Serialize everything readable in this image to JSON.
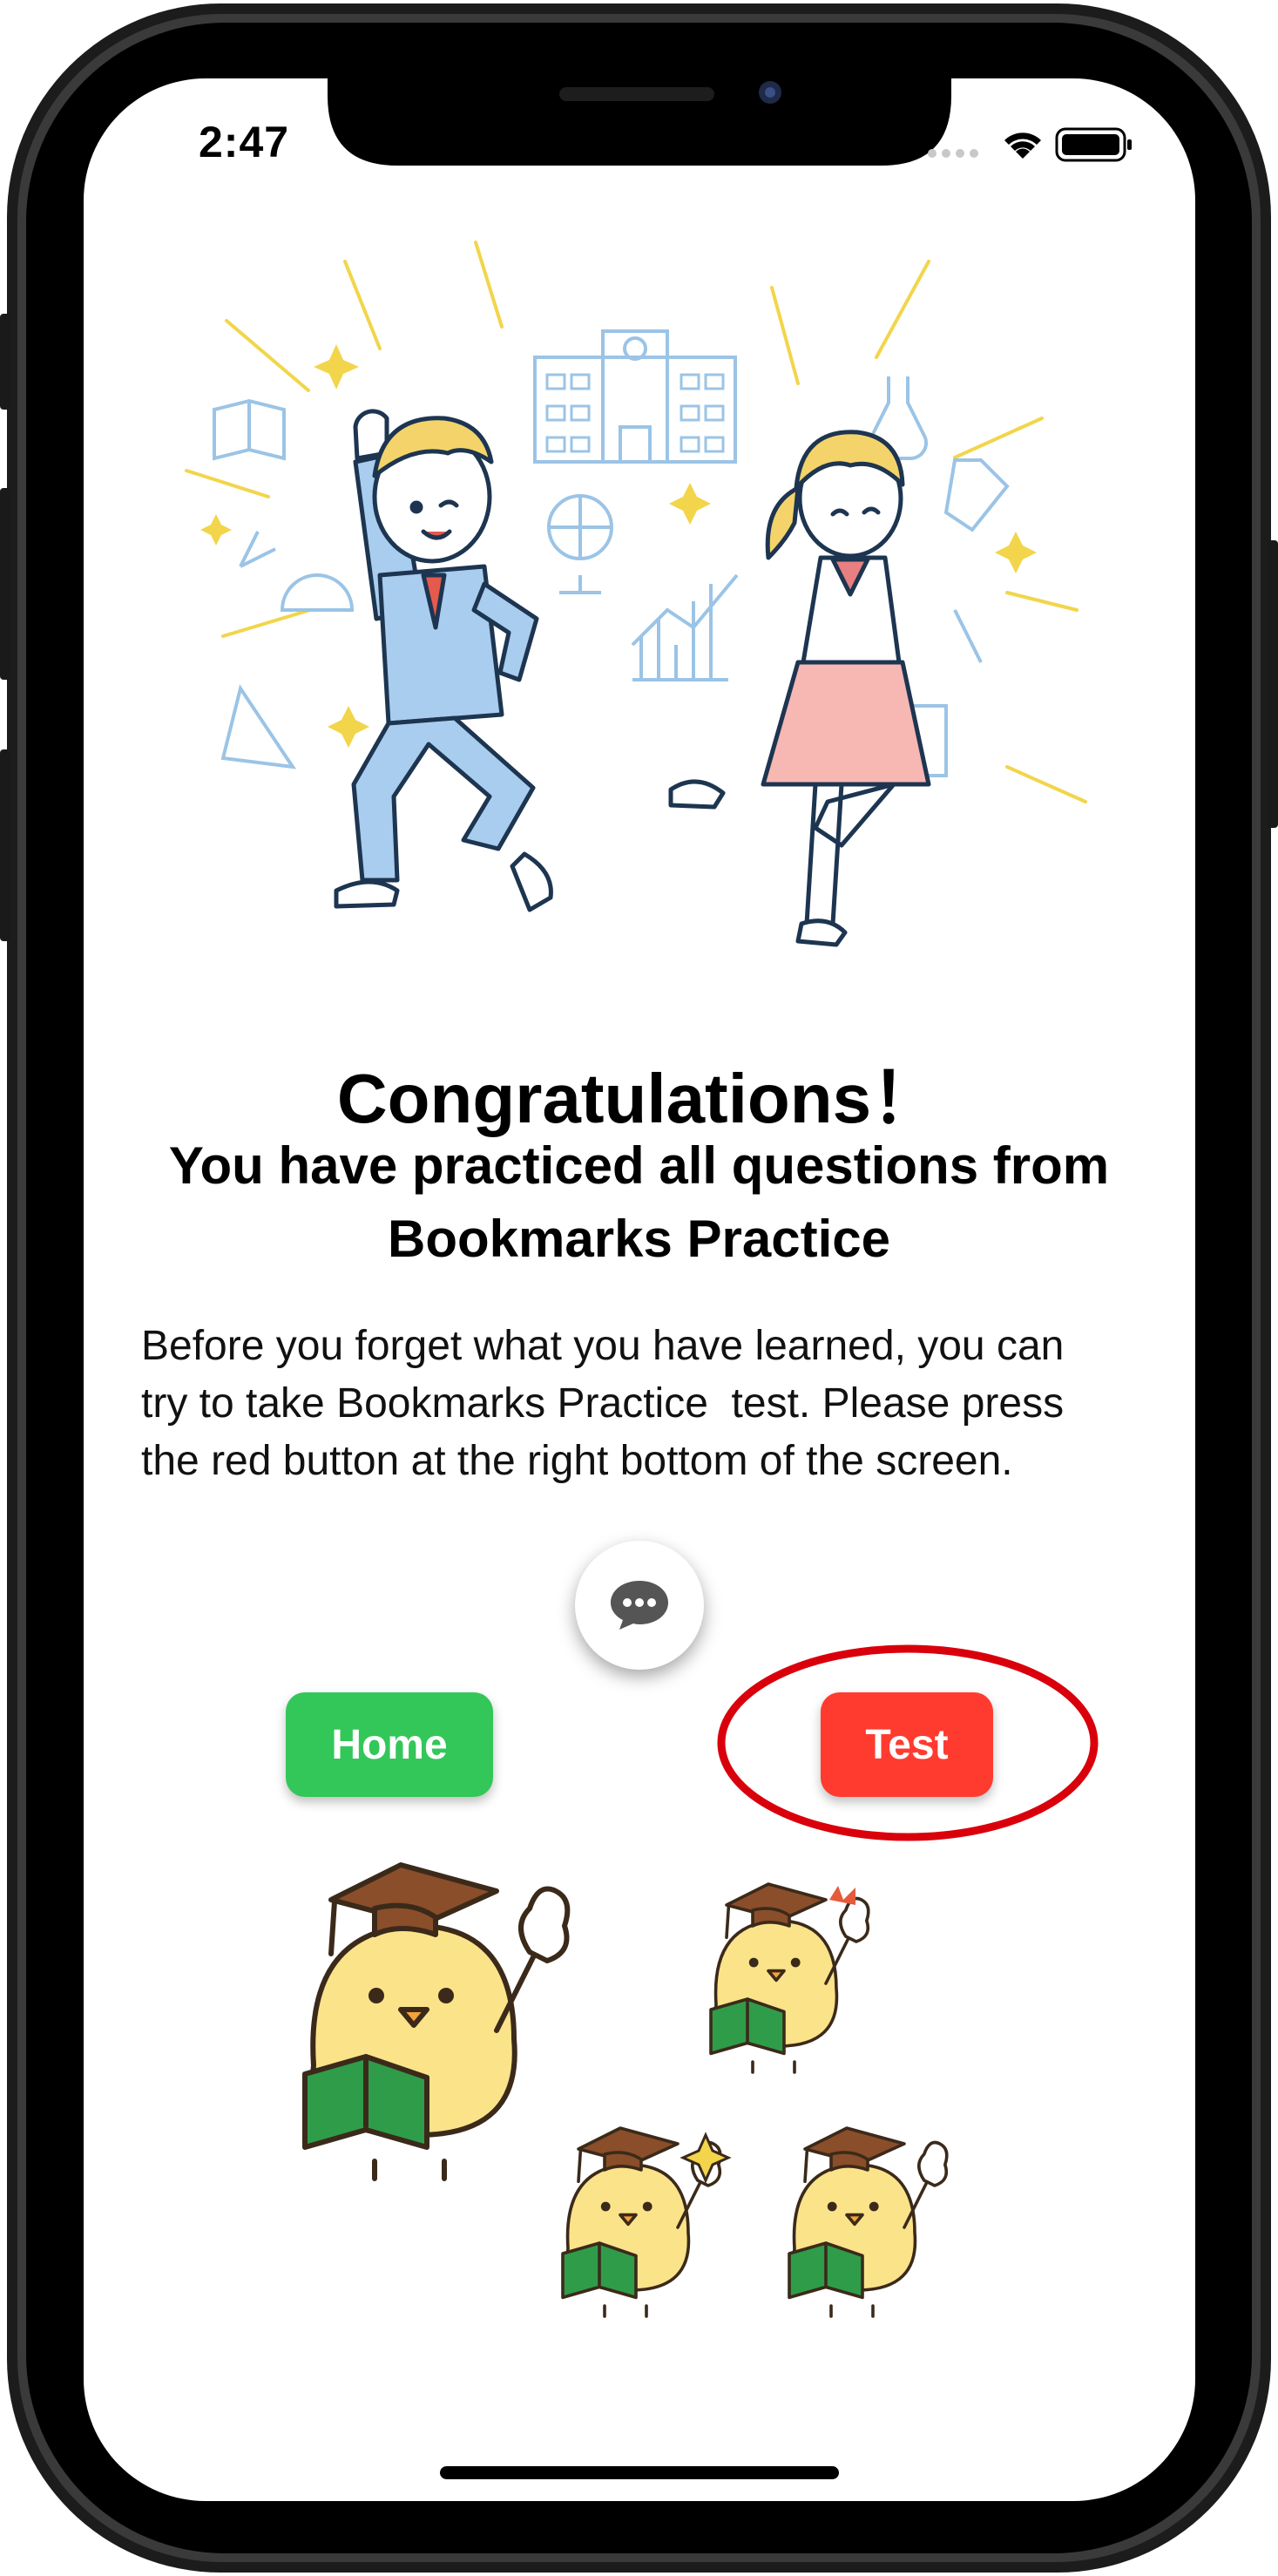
{
  "status_bar": {
    "time": "2:47",
    "icons": [
      "signal-dots-icon",
      "wifi-icon",
      "battery-icon"
    ]
  },
  "illustrations": {
    "hero": "celebrating-students-illustration",
    "bottom": "graduation-chicks-illustration"
  },
  "headline": {
    "title": "Congratulations！",
    "subtitle_line1": "You have practiced all questions from",
    "subtitle_line2": "Bookmarks Practice"
  },
  "message": {
    "line1": "Before you forget what you have learned, you can",
    "line2": "try to take Bookmarks Practice  test. Please press",
    "line3": "the red button at the right bottom of the screen."
  },
  "chat_button": {
    "icon": "chat-bubble-icon"
  },
  "buttons": {
    "home_label": "Home",
    "test_label": "Test"
  },
  "colors": {
    "home": "#33c759",
    "test": "#ff3b30",
    "highlight_ring": "#d9000c",
    "phone_frame": "#000000"
  }
}
